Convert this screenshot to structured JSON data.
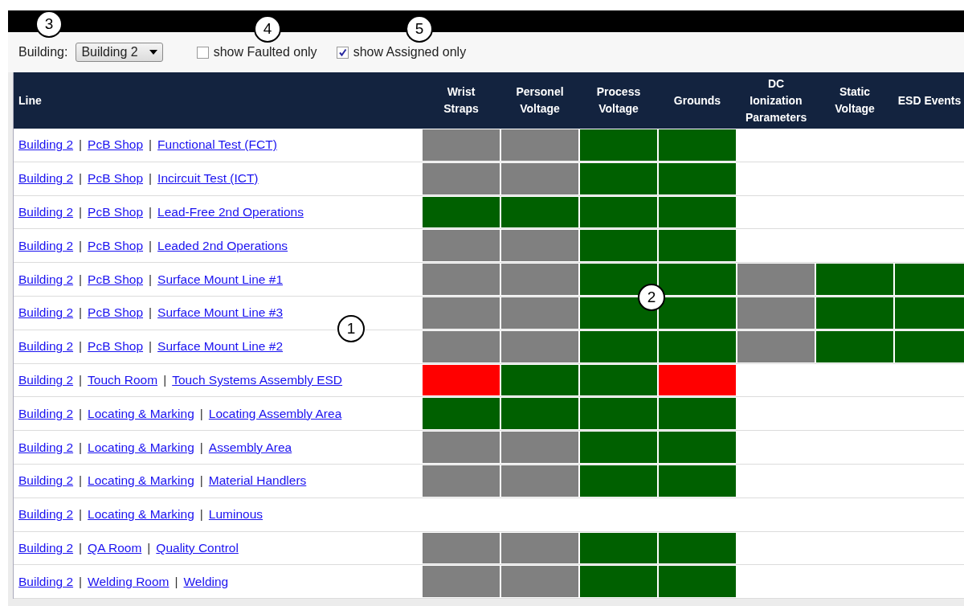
{
  "toolbar": {
    "building_label": "Building:",
    "building_value": "Building 2",
    "checkboxes": [
      {
        "label": "show Faulted only",
        "checked": false
      },
      {
        "label": "show Assigned only",
        "checked": true
      }
    ]
  },
  "table": {
    "columns": [
      "Line",
      "Wrist Straps",
      "Personel Voltage",
      "Process Voltage",
      "Grounds",
      "DC Ionization Parameters",
      "Static Voltage",
      "ESD Events"
    ],
    "rows": [
      {
        "path": [
          "Building 2",
          "|",
          "PcB Shop",
          "|",
          "Functional Test (FCT)"
        ],
        "cells": [
          {
            "color": "#808080"
          },
          {
            "color": "#808080"
          },
          {
            "color": "#006000"
          },
          {
            "color": "#006000"
          }
        ]
      },
      {
        "path": [
          "Building 2",
          "|",
          "PcB Shop",
          "|",
          "Incircuit Test (ICT)"
        ],
        "cells": [
          {
            "color": "#808080"
          },
          {
            "color": "#808080"
          },
          {
            "color": "#006000"
          },
          {
            "color": "#006000"
          }
        ]
      },
      {
        "path": [
          "Building 2",
          "|",
          "PcB Shop",
          "|",
          "Lead-Free 2nd Operations"
        ],
        "cells": [
          {
            "color": "#006000"
          },
          {
            "color": "#006000"
          },
          {
            "color": "#006000"
          },
          {
            "color": "#006000"
          }
        ]
      },
      {
        "path": [
          "Building 2",
          "|",
          "PcB Shop",
          "|",
          "Leaded 2nd Operations"
        ],
        "cells": [
          {
            "color": "#808080"
          },
          {
            "color": "#808080"
          },
          {
            "color": "#006000"
          },
          {
            "color": "#006000"
          }
        ]
      },
      {
        "path": [
          "Building 2",
          "|",
          "PcB Shop",
          "|",
          "Surface Mount Line #1"
        ],
        "cells": [
          {
            "color": "#808080"
          },
          {
            "color": "#808080"
          },
          {
            "color": "#006000"
          },
          {
            "color": "#006000"
          },
          {
            "color": "#808080"
          },
          {
            "color": "#006000"
          },
          {
            "color": "#006000"
          }
        ]
      },
      {
        "path": [
          "Building 2",
          "|",
          "PcB Shop",
          "|",
          "Surface Mount Line #3"
        ],
        "cells": [
          {
            "color": "#808080"
          },
          {
            "color": "#808080"
          },
          {
            "color": "#006000"
          },
          {
            "color": "#006000"
          },
          {
            "color": "#808080"
          },
          {
            "color": "#006000"
          },
          {
            "color": "#006000"
          }
        ]
      },
      {
        "path": [
          "Building 2",
          "|",
          "PcB Shop",
          "|",
          "Surface Mount Line #2"
        ],
        "cells": [
          {
            "color": "#808080"
          },
          {
            "color": "#808080"
          },
          {
            "color": "#006000"
          },
          {
            "color": "#006000"
          },
          {
            "color": "#808080"
          },
          {
            "color": "#006000"
          },
          {
            "color": "#006000"
          }
        ]
      },
      {
        "path": [
          "Building 2",
          "|",
          "Touch Room",
          "|",
          "Touch Systems Assembly ESD"
        ],
        "cells": [
          {
            "color": "#ff0000"
          },
          {
            "color": "#006000"
          },
          {
            "color": "#006000"
          },
          {
            "color": "#ff0000"
          }
        ]
      },
      {
        "path": [
          "Building 2",
          "|",
          "Locating & Marking",
          "|",
          "Locating Assembly Area"
        ],
        "cells": [
          {
            "color": "#006000"
          },
          {
            "color": "#006000"
          },
          {
            "color": "#006000"
          },
          {
            "color": "#006000"
          }
        ]
      },
      {
        "path": [
          "Building 2",
          "|",
          "Locating & Marking",
          "|",
          "Assembly Area"
        ],
        "cells": [
          {
            "color": "#808080"
          },
          {
            "color": "#808080"
          },
          {
            "color": "#006000"
          },
          {
            "color": "#006000"
          }
        ]
      },
      {
        "path": [
          "Building 2",
          "|",
          "Locating & Marking",
          "|",
          "Material Handlers"
        ],
        "cells": [
          {
            "color": "#808080"
          },
          {
            "color": "#808080"
          },
          {
            "color": "#006000"
          },
          {
            "color": "#006000"
          }
        ]
      },
      {
        "path": [
          "Building 2",
          "|",
          "Locating & Marking",
          "|",
          "Luminous"
        ]
      },
      {
        "path": [
          "Building 2",
          "|",
          "QA Room",
          "|",
          "Quality Control"
        ],
        "cells": [
          {
            "color": "#808080"
          },
          {
            "color": "#808080"
          },
          {
            "color": "#006000"
          },
          {
            "color": "#006000"
          }
        ]
      },
      {
        "path": [
          "Building 2",
          "|",
          "Welding Room",
          "|",
          "Welding"
        ],
        "cells": [
          {
            "color": "#808080"
          },
          {
            "color": "#808080"
          },
          {
            "color": "#006000"
          },
          {
            "color": "#006000"
          }
        ]
      }
    ]
  },
  "callouts": [
    "3",
    "4",
    "5",
    "1",
    "2"
  ]
}
